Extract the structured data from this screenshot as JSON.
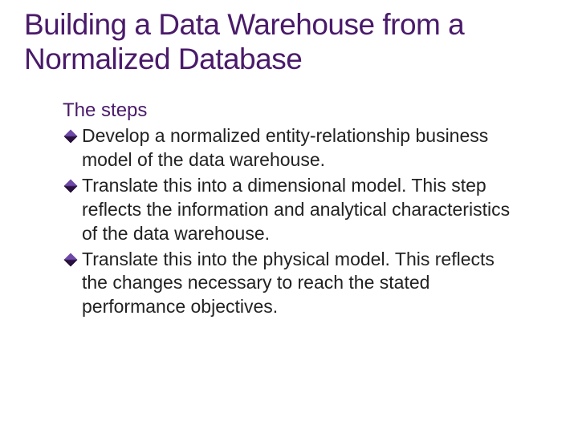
{
  "title": "Building a Data Warehouse from a Normalized Database",
  "subhead": "The steps",
  "bullets": [
    "Develop a normalized entity-relationship business model of the data warehouse.",
    "Translate this into a dimensional model. This step reflects the information and analytical characteristics of the data warehouse.",
    "Translate this into the physical model. This reflects the changes necessary to reach the stated performance objectives."
  ]
}
